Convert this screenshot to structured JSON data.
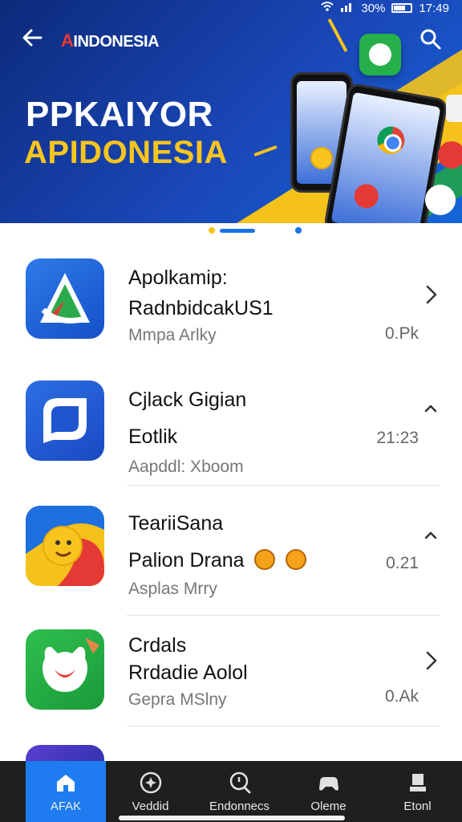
{
  "status_bar": {
    "battery": "30%",
    "time": "17:49"
  },
  "header": {
    "brand_prefix": "A",
    "brand": "INDONESIA"
  },
  "hero": {
    "title": "PPKAIYOR",
    "subtitle": "APIDONESIA"
  },
  "apps": [
    {
      "name": "Apolkamip:",
      "subtitle": "RadnbidcakUS1",
      "meta": "Mmpa Arlky",
      "size": "0.Pk",
      "action": "chevron-right"
    },
    {
      "name": "Cjlack Gigian",
      "subtitle": "Eotlik",
      "meta": "Aapddl: Xboom",
      "size": "21:23",
      "action": "chevron-up"
    },
    {
      "name": "TeariiSana",
      "subtitle": "Palion Drana",
      "meta": "Asplas Mrry",
      "size": "0.21",
      "action": "chevron-up"
    },
    {
      "name": "Crdals",
      "subtitle": "Rrdadie Aolol",
      "meta": "Gepra MSlny",
      "size": "0.Ak",
      "action": "chevron-right"
    }
  ],
  "bottom_nav": [
    {
      "label": "AFAK",
      "icon": "home-icon",
      "active": true
    },
    {
      "label": "Veddid",
      "icon": "sparkle-icon",
      "active": false
    },
    {
      "label": "Endonnecs",
      "icon": "search-icon",
      "active": false
    },
    {
      "label": "Oleme",
      "icon": "gamepad-icon",
      "active": false
    },
    {
      "label": "Etonl",
      "icon": "library-icon",
      "active": false
    }
  ],
  "colors": {
    "accent": "#1e7cf0",
    "hero_bg": "#1a47b8",
    "hero_yellow": "#f7c51e",
    "nav_bg": "#1f1f1f"
  }
}
